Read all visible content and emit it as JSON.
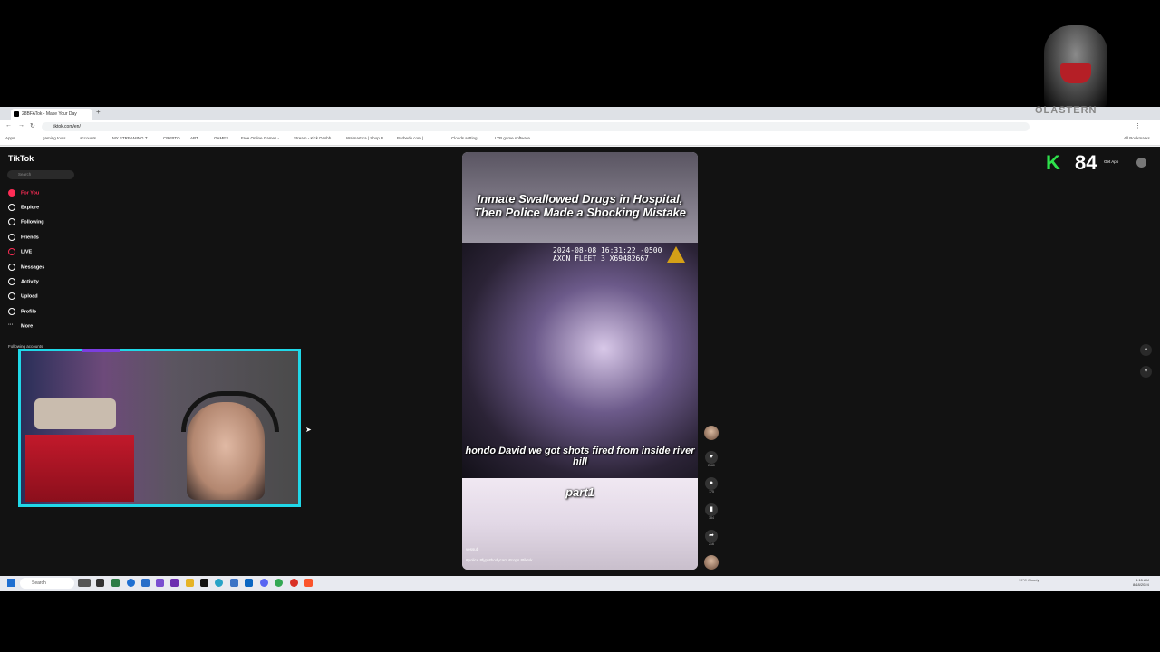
{
  "browser": {
    "tab_title": "28BFATok - Make Your Day",
    "new_tab_icon": "+",
    "url": "tiktok.com/en/",
    "bookmarks": [
      "Apps",
      "gaming tools",
      "accounts",
      "MY STREAMING T...",
      "CRYPTO",
      "ART",
      "GAMES",
      "Free Online Games -...",
      "Stream - Kick Dashb...",
      "Walmart.ca | Shop B...",
      "Barbedo.com | ...",
      "Clouds setting",
      "LYB game software"
    ],
    "all_bookmarks": "All Bookmarks"
  },
  "tiktok": {
    "logo": "TikTok",
    "search_placeholder": "Search",
    "nav": [
      {
        "label": "For You",
        "icon": "home-icon"
      },
      {
        "label": "Explore",
        "icon": "compass-icon"
      },
      {
        "label": "Following",
        "icon": "following-icon"
      },
      {
        "label": "Friends",
        "icon": "friends-icon"
      },
      {
        "label": "LIVE",
        "icon": "live-icon"
      },
      {
        "label": "Messages",
        "icon": "message-icon"
      },
      {
        "label": "Activity",
        "icon": "activity-icon"
      },
      {
        "label": "Upload",
        "icon": "upload-icon"
      },
      {
        "label": "Profile",
        "icon": "profile-icon"
      },
      {
        "label": "More",
        "icon": "more-icon"
      }
    ],
    "following_accounts": "Following accounts",
    "get_app": "Get App"
  },
  "video": {
    "title": "Inmate Swallowed Drugs in Hospital, Then Police Made a Shocking Mistake",
    "timestamp_line1": "2024-08-08 16:31:22 -0500",
    "timestamp_line2": "AXON FLEET 3 X69482667",
    "subtitle": "hondo David we got shots fired from inside river hill",
    "part": "part1",
    "username": "yessub",
    "hashtags": "#police #fyp #bodycam #cops #tiktok",
    "likes": "2160",
    "comments": "175",
    "bookmarks": "384",
    "shares": "216"
  },
  "overlay": {
    "k_logo": "K",
    "number": "84",
    "channel": "OLASTERN"
  },
  "taskbar": {
    "search_placeholder": "Search",
    "weather": "19°C Cloudy",
    "time": "4:15 AM",
    "date": "8/18/2024"
  }
}
